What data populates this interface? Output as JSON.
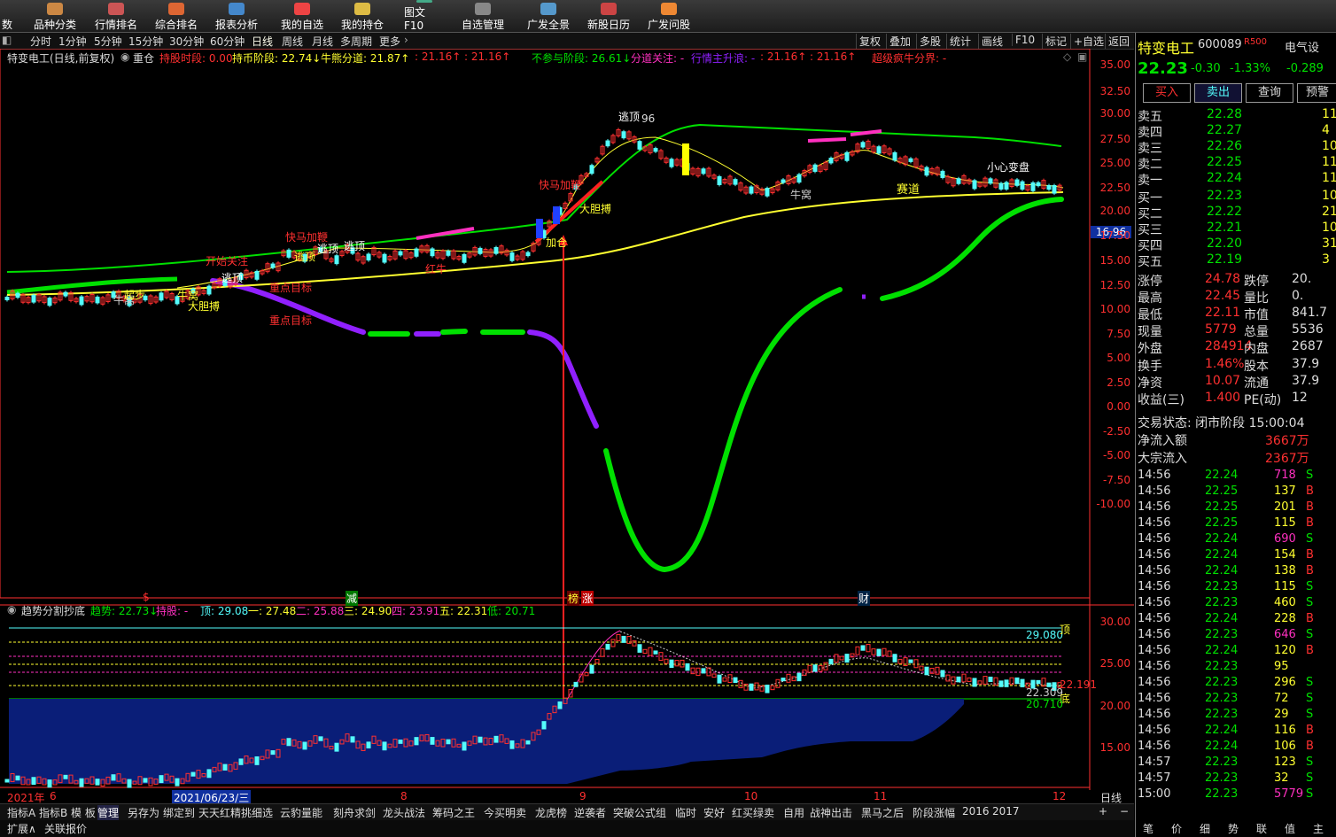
{
  "toolbar": {
    "items": [
      {
        "label": "数"
      },
      {
        "label": "品种分类"
      },
      {
        "label": "行情排名"
      },
      {
        "label": "综合排名"
      },
      {
        "label": "报表分析"
      },
      {
        "label": "我的自选"
      },
      {
        "label": "我的持仓"
      },
      {
        "label": "图文F10"
      },
      {
        "label": "自选管理"
      },
      {
        "label": "广发全景"
      },
      {
        "label": "新股日历"
      },
      {
        "label": "广发问股"
      }
    ]
  },
  "periods": [
    "分时",
    "1分钟",
    "5分钟",
    "15分钟",
    "30分钟",
    "60分钟",
    "日线",
    "周线",
    "月线",
    "多周期",
    "更多"
  ],
  "right_tools": [
    "复权",
    "叠加",
    "多股",
    "统计",
    "画线",
    "F10",
    "标记",
    "+自选",
    "返回"
  ],
  "infoline": {
    "title": "特变电工(日线,前复权)",
    "heavy": "重仓",
    "f1": "持股时段: 0.00",
    "f2": "持币阶段: 22.74↓",
    "f3": "牛熊分道: 21.87↑",
    "f4": ": 21.16↑",
    "f5": ": 21.16↑",
    "f6": "不参与阶段: 26.61↓",
    "f7": "分道关注: -",
    "f8": "行情主升浪: -",
    "f9": ": 21.16↑",
    "f10": ": 21.16↑",
    "f11": "超级疯牛分界: -"
  },
  "main_axis": [
    "35.00",
    "32.50",
    "30.00",
    "27.50",
    "25.00",
    "22.50",
    "20.00",
    "17.50",
    "15.00",
    "12.50",
    "10.00",
    "7.50",
    "5.00",
    "2.50",
    "0.00",
    "-2.50",
    "-5.00",
    "-7.50",
    "-10.00"
  ],
  "price_marker": "16.96",
  "annotations": {
    "a1": "逃顶",
    "a2": "96",
    "a3": "快马加鞭",
    "a4": "大胆搏",
    "a5": "快马加鞭",
    "a6": "逃顶",
    "a7": "逃顶",
    "a8": "开始关注",
    "a9": "逃顶",
    "a10": "重点目标",
    "a11": "重点目标",
    "a12": "红牛",
    "a13": "加仓",
    "a14": "牛窝",
    "a15": "大胆搏",
    "a16": "小心变盘",
    "a17": "赛道",
    "a18": "牛窝",
    "a19": "牛窝",
    "a20": "起步",
    "a21": "逃顶",
    "s1": "$",
    "s2": "减",
    "s3": "榜",
    "s4": "涨",
    "s5": "财"
  },
  "ind2": {
    "title": "趋势分割抄底",
    "trend": "趋势: 22.73↓",
    "hold": "持股: -",
    "top": "顶: 29.08",
    "l1": "一: 27.48",
    "l2": "二: 25.88",
    "l3": "三: 24.90",
    "l4": "四: 23.91",
    "l5": "五: 22.31",
    "low": "低: 20.71",
    "axis": [
      "30.00",
      "25.00",
      "20.00",
      "15.00"
    ],
    "lab_top": "29.080",
    "lab_mid": "22.309",
    "lab_bot": "20.710",
    "lab_cur": "22.191",
    "tag_top": "顶",
    "tag_bot": "底"
  },
  "dates": [
    "2021年",
    "6",
    "2021/06/23/三",
    "8",
    "9",
    "10",
    "11",
    "12"
  ],
  "date_right": "日线",
  "tabs": [
    "指标A",
    "指标B",
    "模 板",
    "管理",
    "另存为",
    "绑定到",
    "天天红精挑细选",
    "云豹量能",
    "刻舟求剑",
    "龙头战法",
    "筹码之王",
    "今买明卖",
    "龙虎榜",
    "逆袭者",
    "突破公式组",
    "临时",
    "安好",
    "红买绿卖",
    "自用",
    "战神出击",
    "黑马之后",
    "阶段涨幅",
    "2016",
    "2017"
  ],
  "bottom": [
    "扩展∧",
    "关联报价"
  ],
  "stock": {
    "name": "特变电工",
    "code": "600089",
    "flag": "R500",
    "sector": "电气设",
    "price": "22.23",
    "change": "-0.30",
    "pct": "-1.33%",
    "sector_pct": "-0.289",
    "buttons": [
      "买入",
      "卖出",
      "查询",
      "预警"
    ],
    "asks": [
      {
        "label": "卖五",
        "price": "22.28",
        "vol": "11"
      },
      {
        "label": "卖四",
        "price": "22.27",
        "vol": "4"
      },
      {
        "label": "卖三",
        "price": "22.26",
        "vol": "10"
      },
      {
        "label": "卖二",
        "price": "22.25",
        "vol": "11"
      },
      {
        "label": "卖一",
        "price": "22.24",
        "vol": "11"
      }
    ],
    "bids": [
      {
        "label": "买一",
        "price": "22.23",
        "vol": "10"
      },
      {
        "label": "买二",
        "price": "22.22",
        "vol": "21"
      },
      {
        "label": "买三",
        "price": "22.21",
        "vol": "10"
      },
      {
        "label": "买四",
        "price": "22.20",
        "vol": "31"
      },
      {
        "label": "买五",
        "price": "22.19",
        "vol": "3"
      }
    ],
    "stats": [
      {
        "l": "涨停",
        "v": "24.78",
        "l2": "跌停",
        "v2": "20."
      },
      {
        "l": "最高",
        "v": "22.45",
        "l2": "量比",
        "v2": "0."
      },
      {
        "l": "最低",
        "v": "22.11",
        "l2": "市值",
        "v2": "841.7"
      },
      {
        "l": "现量",
        "v": "5779",
        "l2": "总量",
        "v2": "5536"
      },
      {
        "l": "外盘",
        "v": "284914",
        "l2": "内盘",
        "v2": "2687"
      }
    ],
    "stats2": [
      {
        "l": "换手",
        "v": "1.46%",
        "l2": "股本",
        "v2": "37.9"
      },
      {
        "l": "净资",
        "v": "10.07",
        "l2": "流通",
        "v2": "37.9"
      },
      {
        "l": "收益(三)",
        "v": "1.400",
        "l2": "PE(动)",
        "v2": "12"
      }
    ],
    "status": "交易状态: 闭市阶段 15:00:04",
    "flow1_l": "净流入额",
    "flow1_v": "3667万",
    "flow2_l": "大宗流入",
    "flow2_v": "2367万",
    "ticks": [
      {
        "t": "14:56",
        "p": "22.24",
        "v": "718",
        "d": "S"
      },
      {
        "t": "14:56",
        "p": "22.25",
        "v": "137",
        "d": "B"
      },
      {
        "t": "14:56",
        "p": "22.25",
        "v": "201",
        "d": "B"
      },
      {
        "t": "14:56",
        "p": "22.25",
        "v": "115",
        "d": "B"
      },
      {
        "t": "14:56",
        "p": "22.24",
        "v": "690",
        "d": "S"
      },
      {
        "t": "14:56",
        "p": "22.24",
        "v": "154",
        "d": "B"
      },
      {
        "t": "14:56",
        "p": "22.24",
        "v": "138",
        "d": "B"
      },
      {
        "t": "14:56",
        "p": "22.23",
        "v": "115",
        "d": "S"
      },
      {
        "t": "14:56",
        "p": "22.23",
        "v": "460",
        "d": "S"
      },
      {
        "t": "14:56",
        "p": "22.24",
        "v": "228",
        "d": "B"
      },
      {
        "t": "14:56",
        "p": "22.23",
        "v": "646",
        "d": "S"
      },
      {
        "t": "14:56",
        "p": "22.24",
        "v": "120",
        "d": "B"
      },
      {
        "t": "14:56",
        "p": "22.23",
        "v": "95",
        "d": ""
      },
      {
        "t": "14:56",
        "p": "22.23",
        "v": "296",
        "d": "S"
      },
      {
        "t": "14:56",
        "p": "22.23",
        "v": "72",
        "d": "S"
      },
      {
        "t": "14:56",
        "p": "22.23",
        "v": "29",
        "d": "S"
      },
      {
        "t": "14:56",
        "p": "22.24",
        "v": "116",
        "d": "B"
      },
      {
        "t": "14:56",
        "p": "22.24",
        "v": "106",
        "d": "B"
      },
      {
        "t": "14:57",
        "p": "22.23",
        "v": "123",
        "d": "S"
      },
      {
        "t": "14:57",
        "p": "22.23",
        "v": "32",
        "d": "S"
      },
      {
        "t": "15:00",
        "p": "22.23",
        "v": "5779",
        "d": "S"
      }
    ],
    "bottom_tabs": [
      "笔",
      "价",
      "细",
      "势",
      "联",
      "值",
      "主"
    ]
  },
  "colors": {
    "up": "#ff3030",
    "down": "#54fcfc",
    "green": "#00e000",
    "purple": "#9020ff",
    "yellow": "#ffff30",
    "magenta": "#ff30c0",
    "navy": "#0a1e78"
  }
}
